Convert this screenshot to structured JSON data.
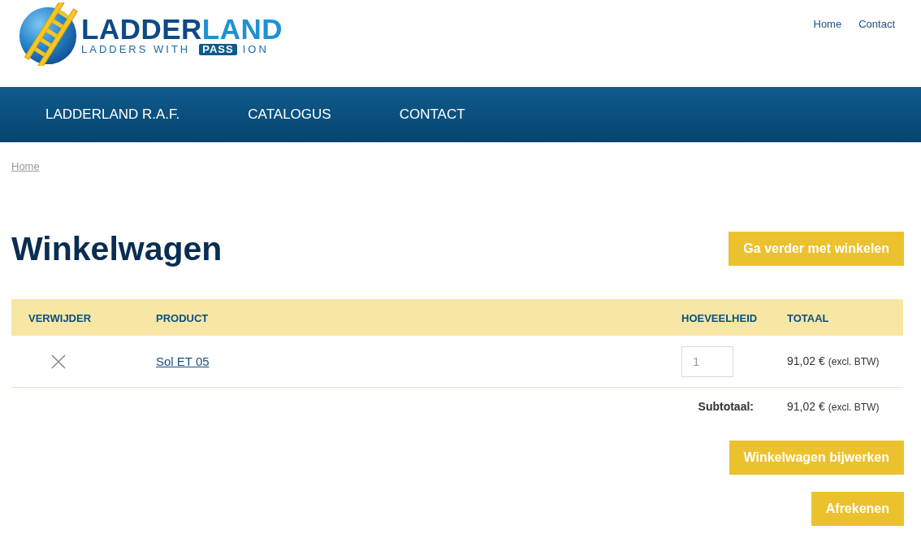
{
  "logo": {
    "wordmark_parts": [
      {
        "text": "LADDER"
      },
      {
        "text": "LAND"
      }
    ],
    "tagline_start": "LADDERS WITH",
    "tagline_badge": "PASS",
    "tagline_end": "ION"
  },
  "top_links": [
    {
      "label": "Home"
    },
    {
      "label": "Contact"
    }
  ],
  "main_nav": [
    {
      "label": "LADDERLAND R.A.F."
    },
    {
      "label": "CATALOGUS"
    },
    {
      "label": "CONTACT"
    }
  ],
  "breadcrumb": [
    {
      "label": "Home"
    }
  ],
  "title": "Winkelwagen",
  "continue_button": "Ga verder met winkelen",
  "cart_table": {
    "columns": [
      "VERWIJDER",
      "PRODUCT",
      "HOEVEELHEID",
      "TOTAAL"
    ],
    "rows": [
      {
        "product": "Sol ET 05",
        "quantity": "1",
        "total": "91,02 €",
        "tax_note": "(excl. BTW)"
      }
    ]
  },
  "subtotal": {
    "label": "Subtotaal:",
    "amount": "91,02 €",
    "tax_note": "(excl. BTW)"
  },
  "action_buttons": [
    {
      "label": "Winkelwagen bijwerken"
    },
    {
      "label": "Afrekenen"
    }
  ]
}
